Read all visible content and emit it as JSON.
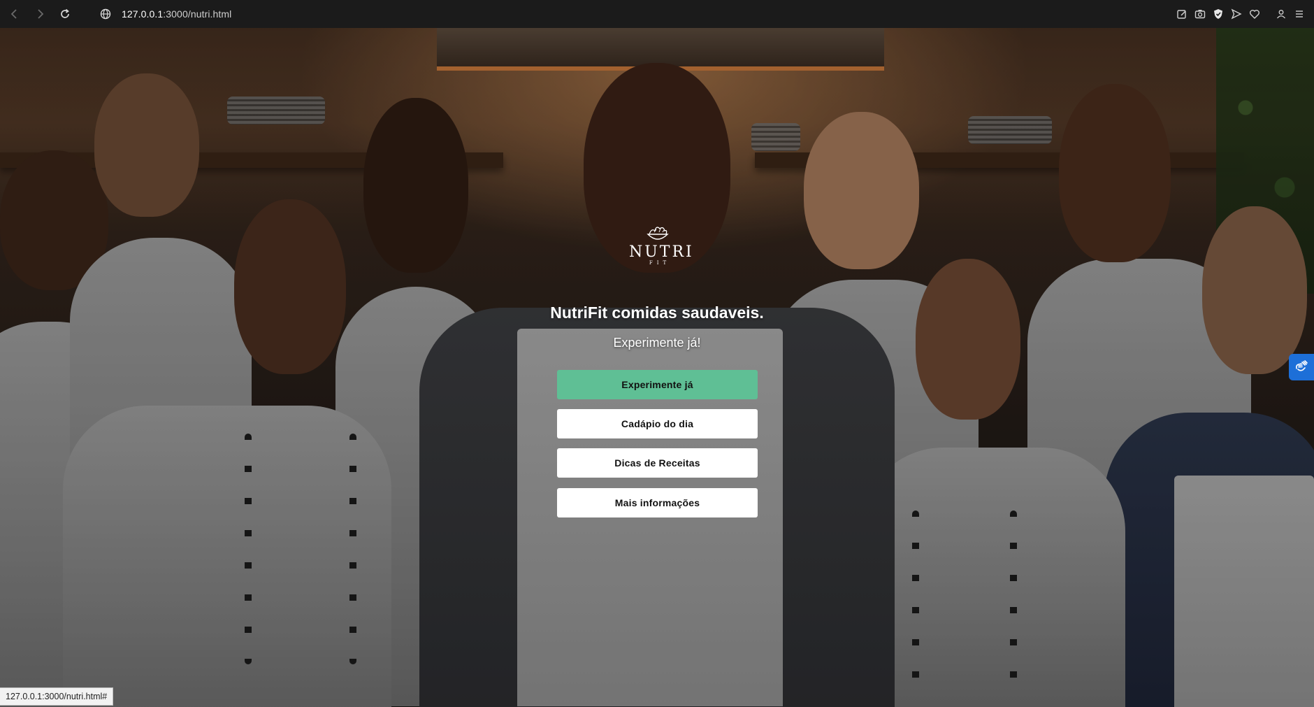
{
  "browser": {
    "url_host": "127.0.0.1",
    "url_rest": ":3000/nutri.html",
    "status_url": "127.0.0.1:3000/nutri.html#"
  },
  "logo": {
    "word": "NUTRI",
    "sub": "FIT"
  },
  "hero": {
    "title": "NutriFit comidas saudaveis.",
    "subtitle": "Experimente já!",
    "buttons": [
      {
        "label": "Experimente já",
        "style": "primary"
      },
      {
        "label": "Cadápio do dia",
        "style": "secondary"
      },
      {
        "label": "Dicas de Receitas",
        "style": "secondary"
      },
      {
        "label": "Mais informações",
        "style": "secondary"
      }
    ]
  },
  "colors": {
    "primary_button": "#5fbf95",
    "secondary_button": "#ffffff",
    "accessibility_widget": "#1d6fd8"
  },
  "icons": {
    "nav": [
      "back-icon",
      "forward-icon",
      "reload-icon",
      "site-info-icon"
    ],
    "toolbar_right": [
      "edit-page-icon",
      "screenshot-icon",
      "shield-icon",
      "send-icon",
      "favorite-icon",
      "profile-icon",
      "menu-icon"
    ],
    "accessibility": "sign-language-icon"
  }
}
